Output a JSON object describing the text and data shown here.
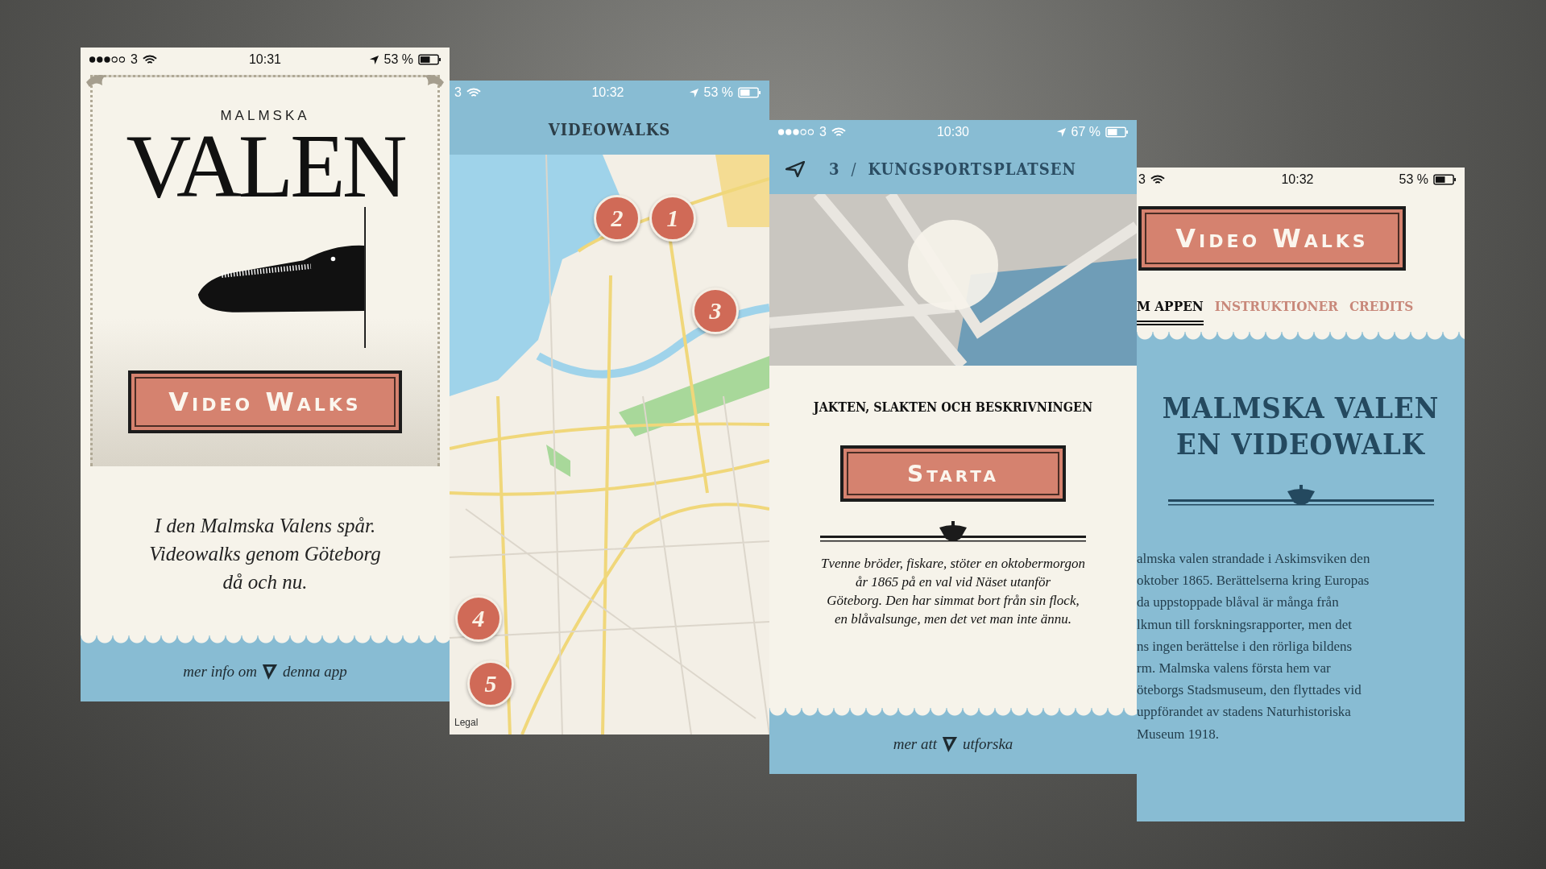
{
  "screens": [
    {
      "kind": "splash",
      "status": {
        "carrier": "3",
        "time": "10:31",
        "battery": "53 %",
        "signal": true,
        "location": true
      },
      "kicker": "MALMSKA",
      "logo": "VALEN",
      "button": "Video Walks",
      "tagline": "I den Malmska Valens spår.\nVideowalks genom Göteborg\ndå och nu.",
      "footer": [
        "mer info om",
        "denna app"
      ]
    },
    {
      "kind": "map",
      "status": {
        "carrier": "3",
        "time": "10:32",
        "battery": "53 %",
        "signal": false,
        "location": true
      },
      "title": "VIDEOWALKS",
      "pins": [
        "2",
        "1",
        "3",
        "4",
        "5"
      ],
      "legal": "Legal"
    },
    {
      "kind": "detail",
      "status": {
        "carrier": "3",
        "time": "10:30",
        "battery": "67 %",
        "signal": true,
        "location": true
      },
      "step": "3",
      "separator": "/",
      "place": "KUNGSPORTSPLATSEN",
      "heading": "JAKTEN, SLAKTEN OCH BESKRIVNINGEN",
      "button": "Starta",
      "body": "Tvenne bröder, fiskare, stöter en oktobermorgon\når 1865 på en val vid Näset utanför\nGöteborg. Den har simmat bort från sin flock,\nen blåvalsunge, men det vet man inte ännu.",
      "footer": [
        "mer att",
        "utforska"
      ]
    },
    {
      "kind": "about",
      "status": {
        "carrier": "3",
        "time": "10:32",
        "battery": "53 %",
        "signal": false,
        "location": false
      },
      "button": "Video Walks",
      "tabs": [
        {
          "label": "M APPEN",
          "selected": true
        },
        {
          "label": "INSTRUKTIONER",
          "selected": false
        },
        {
          "label": "CREDITS",
          "selected": false
        }
      ],
      "title": "MALMSKA VALEN\nEN VIDEOWALK",
      "body": "almska valen strandade i Askimsviken den\n oktober 1865. Berättelserna kring Europas\nda uppstoppade blåval är många från\nlkmun till forskningsrapporter, men det\nns ingen berättelse i den rörliga bildens\nrm. Malmska valens första hem var\nöteborgs Stadsmuseum, den flyttades vid\nuppförandet av stadens Naturhistoriska\nMuseum 1918."
    }
  ]
}
